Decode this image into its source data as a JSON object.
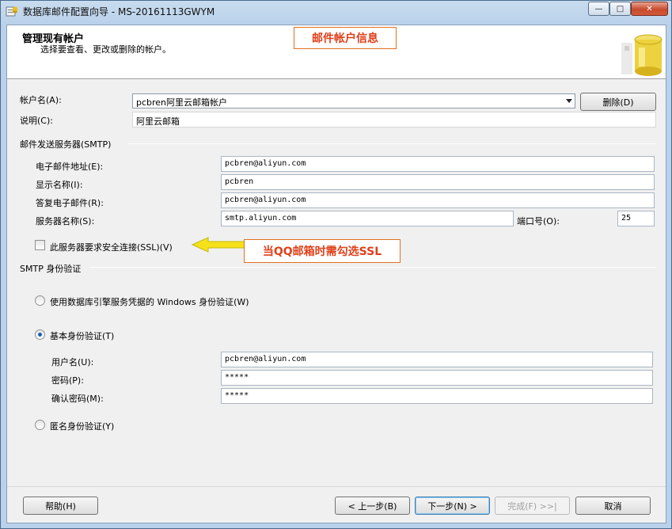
{
  "window": {
    "title": "数据库邮件配置向导 - MS-20161113GWYM",
    "minimize": "—",
    "maximize": "□",
    "close": "✕"
  },
  "header": {
    "title": "管理现有帐户",
    "subtitle": "选择要查看、更改或删除的帐户。",
    "callout": "邮件帐户信息"
  },
  "account": {
    "name_label": "帐户名(A):",
    "name_value": "pcbren阿里云邮箱帐户",
    "delete_button": "删除(D)",
    "desc_label": "说明(C):",
    "desc_value": "阿里云邮箱"
  },
  "smtp": {
    "group_label": "邮件发送服务器(SMTP)",
    "email_label": "电子邮件地址(E):",
    "email_value": "pcbren@aliyun.com",
    "display_label": "显示名称(I):",
    "display_value": "pcbren",
    "reply_label": "答复电子邮件(R):",
    "reply_value": "pcbren@aliyun.com",
    "server_label": "服务器名称(S):",
    "server_value": "smtp.aliyun.com",
    "port_label": "端口号(O):",
    "port_value": "25",
    "ssl_label": "此服务器要求安全连接(SSL)(V)",
    "ssl_checked": false,
    "ssl_callout": "当QQ邮箱时需勾选SSL"
  },
  "auth": {
    "group_label": "SMTP 身份验证",
    "windows_label": "使用数据库引擎服务凭据的 Windows 身份验证(W)",
    "basic_label": "基本身份验证(T)",
    "selected": "basic",
    "username_label": "用户名(U):",
    "username_value": "pcbren@aliyun.com",
    "password_label": "密码(P):",
    "password_value": "*****",
    "confirm_label": "确认密码(M):",
    "confirm_value": "*****",
    "anonymous_label": "匿名身份验证(Y)"
  },
  "footer": {
    "help": "帮助(H)",
    "back": "< 上一步(B)",
    "next": "下一步(N) >",
    "finish": "完成(F) >>|",
    "cancel": "取消"
  },
  "colors": {
    "callout_text": "#e0401a",
    "callout_border": "#e07020",
    "arrow_fill": "#f5e11a"
  }
}
